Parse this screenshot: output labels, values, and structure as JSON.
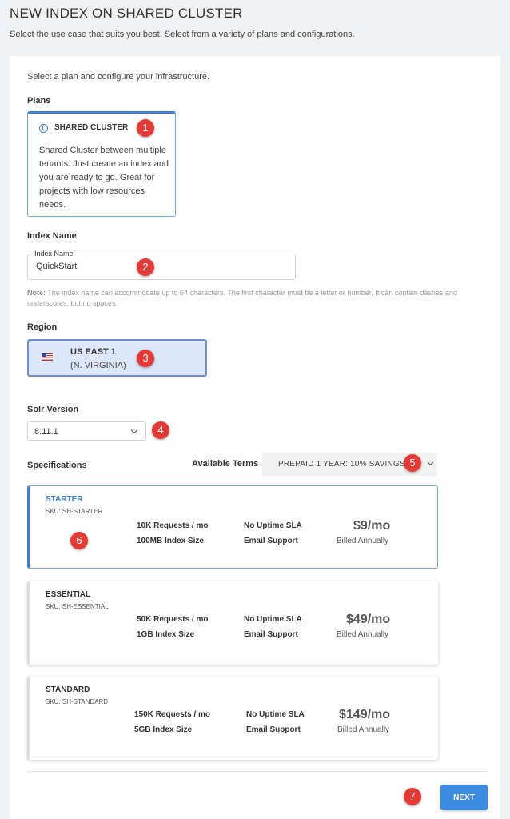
{
  "header": {
    "title": "NEW INDEX ON SHARED CLUSTER",
    "subtitle": "Select the use case that suits you best. Select from a variety of plans and configurations."
  },
  "intro": "Select a plan and configure your infrastructure.",
  "plans": {
    "label": "Plans",
    "card": {
      "title": "SHARED CLUSTER",
      "description": "Shared Cluster between multiple tenants. Just create an index and you are ready to go. Great for projects with low resources needs."
    }
  },
  "index_name": {
    "label": "Index Name",
    "field_label": "Index Name",
    "value": "QuickStart",
    "note_prefix": "Note:",
    "note": " The index name can accommodate up to 64 characters. The first character must be a letter or number. It can contain dashes and underscores, but no spaces."
  },
  "region": {
    "label": "Region",
    "name": "US EAST 1",
    "sub": "(N. VIRGINIA)"
  },
  "solr": {
    "label": "Solr Version",
    "value": "8.11.1"
  },
  "specifications": {
    "label": "Specifications",
    "terms_label": "Available Terms",
    "terms_value": "PREPAID 1 YEAR: 10% SAVINGS",
    "cards": [
      {
        "name": "STARTER",
        "sku": "SKU: SH-STARTER",
        "requests": "10K Requests / mo",
        "size": "100MB Index Size",
        "sla": "No Uptime SLA",
        "support": "Email Support",
        "price": "$9/mo",
        "billed": "Billed Annually"
      },
      {
        "name": "ESSENTIAL",
        "sku": "SKU: SH-ESSENTIAL",
        "requests": "50K Requests / mo",
        "size": "1GB Index Size",
        "sla": "No Uptime SLA",
        "support": "Email Support",
        "price": "$49/mo",
        "billed": "Billed Annually"
      },
      {
        "name": "STANDARD",
        "sku": "SKU: SH-STANDARD",
        "requests": "150K Requests / mo",
        "size": "5GB Index Size",
        "sla": "No Uptime SLA",
        "support": "Email Support",
        "price": "$149/mo",
        "billed": "Billed Annually"
      }
    ]
  },
  "next_label": "NEXT",
  "annotations": [
    "1",
    "2",
    "3",
    "4",
    "5",
    "6",
    "7"
  ],
  "colors": {
    "accent": "#3b82d6",
    "badge": "#e53935",
    "region_bg": "#dde7fb"
  }
}
